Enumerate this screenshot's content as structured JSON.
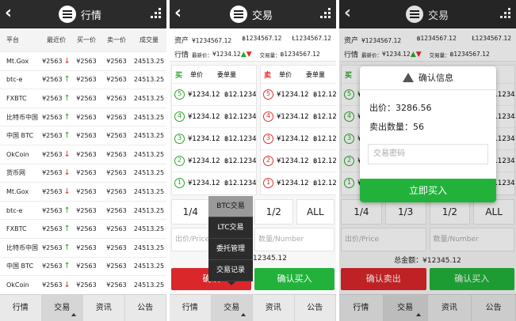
{
  "screen1": {
    "title": "行情",
    "headers": [
      "平台",
      "最近价",
      "买一价",
      "卖一价",
      "成交量"
    ],
    "rows": [
      {
        "name": "Mt.Gox",
        "last": "¥2563",
        "dir": "down",
        "buy": "¥2563",
        "sell": "¥2563",
        "vol": "24513.25"
      },
      {
        "name": "btc-e",
        "last": "¥2563",
        "dir": "up",
        "buy": "¥2563",
        "sell": "¥2563",
        "vol": "24513.25"
      },
      {
        "name": "FXBTC",
        "last": "¥2563",
        "dir": "up",
        "buy": "¥2563",
        "sell": "¥2563",
        "vol": "24513.25"
      },
      {
        "name": "比特币中国",
        "last": "¥2563",
        "dir": "up",
        "buy": "¥2563",
        "sell": "¥2563",
        "vol": "24513.25"
      },
      {
        "name": "中国 BTC",
        "last": "¥2563",
        "dir": "up",
        "buy": "¥2563",
        "sell": "¥2563",
        "vol": "24513.25"
      },
      {
        "name": "OkCoin",
        "last": "¥2563",
        "dir": "down",
        "buy": "¥2563",
        "sell": "¥2563",
        "vol": "24513.25"
      },
      {
        "name": "货币网",
        "last": "¥2563",
        "dir": "down",
        "buy": "¥2563",
        "sell": "¥2563",
        "vol": "24513.25"
      },
      {
        "name": "Mt.Gox",
        "last": "¥2563",
        "dir": "down",
        "buy": "¥2563",
        "sell": "¥2563",
        "vol": "24513.25"
      },
      {
        "name": "btc-e",
        "last": "¥2563",
        "dir": "up",
        "buy": "¥2563",
        "sell": "¥2563",
        "vol": "24513.25"
      },
      {
        "name": "FXBTC",
        "last": "¥2563",
        "dir": "up",
        "buy": "¥2563",
        "sell": "¥2563",
        "vol": "24513.25"
      },
      {
        "name": "比特币中国",
        "last": "¥2563",
        "dir": "up",
        "buy": "¥2563",
        "sell": "¥2563",
        "vol": "24513.25"
      },
      {
        "name": "中国 BTC",
        "last": "¥2563",
        "dir": "up",
        "buy": "¥2563",
        "sell": "¥2563",
        "vol": "24513.25"
      },
      {
        "name": "OkCoin",
        "last": "¥2563",
        "dir": "down",
        "buy": "¥2563",
        "sell": "¥2563",
        "vol": "24513.25"
      }
    ]
  },
  "trade": {
    "title": "交易",
    "assets_label": "资产",
    "asset_cny": "¥1234567.12",
    "asset_btc": "฿1234567.12",
    "asset_ltc": "Ł1234567.12",
    "market_label": "行情",
    "latest_label": "最新价：",
    "latest_value": "¥1234.12",
    "volume_label": "交易量：",
    "volume_value": "฿1234567.12",
    "buy_label": "买",
    "sell_label": "卖",
    "unit_price": "单价",
    "unit_qty": "委单量",
    "order_price": "¥1234.12",
    "order_qty": "฿12.1234",
    "levels": [
      "5",
      "4",
      "3",
      "2",
      "1"
    ],
    "fractions": [
      "1/4",
      "1/3",
      "1/2",
      "ALL"
    ],
    "price_placeholder": "出价/Price",
    "qty_placeholder": "数量/Number",
    "total_label": "总金额：",
    "total_value": "¥12345.12",
    "total_short": "12345.12",
    "sell_button": "确认卖出",
    "buy_button": "确认买入",
    "sell_button_partial": "确认"
  },
  "dropdown": {
    "items": [
      "BTC交易",
      "LTC交易",
      "委托管理",
      "交易记录"
    ]
  },
  "dialog": {
    "title": "确认信息",
    "price_label": "出价：",
    "price_value": "3286.56",
    "qty_label": "卖出数量：",
    "qty_value": "56",
    "password_placeholder": "交易密码",
    "confirm_button": "立即买入"
  },
  "nav": [
    "行情",
    "交易",
    "资讯",
    "公告"
  ],
  "colors": {
    "up": "#2aa52a",
    "down": "#e0302b",
    "buy": "#22b23b",
    "sell": "#d9272a",
    "header": "#2b2b2b"
  }
}
